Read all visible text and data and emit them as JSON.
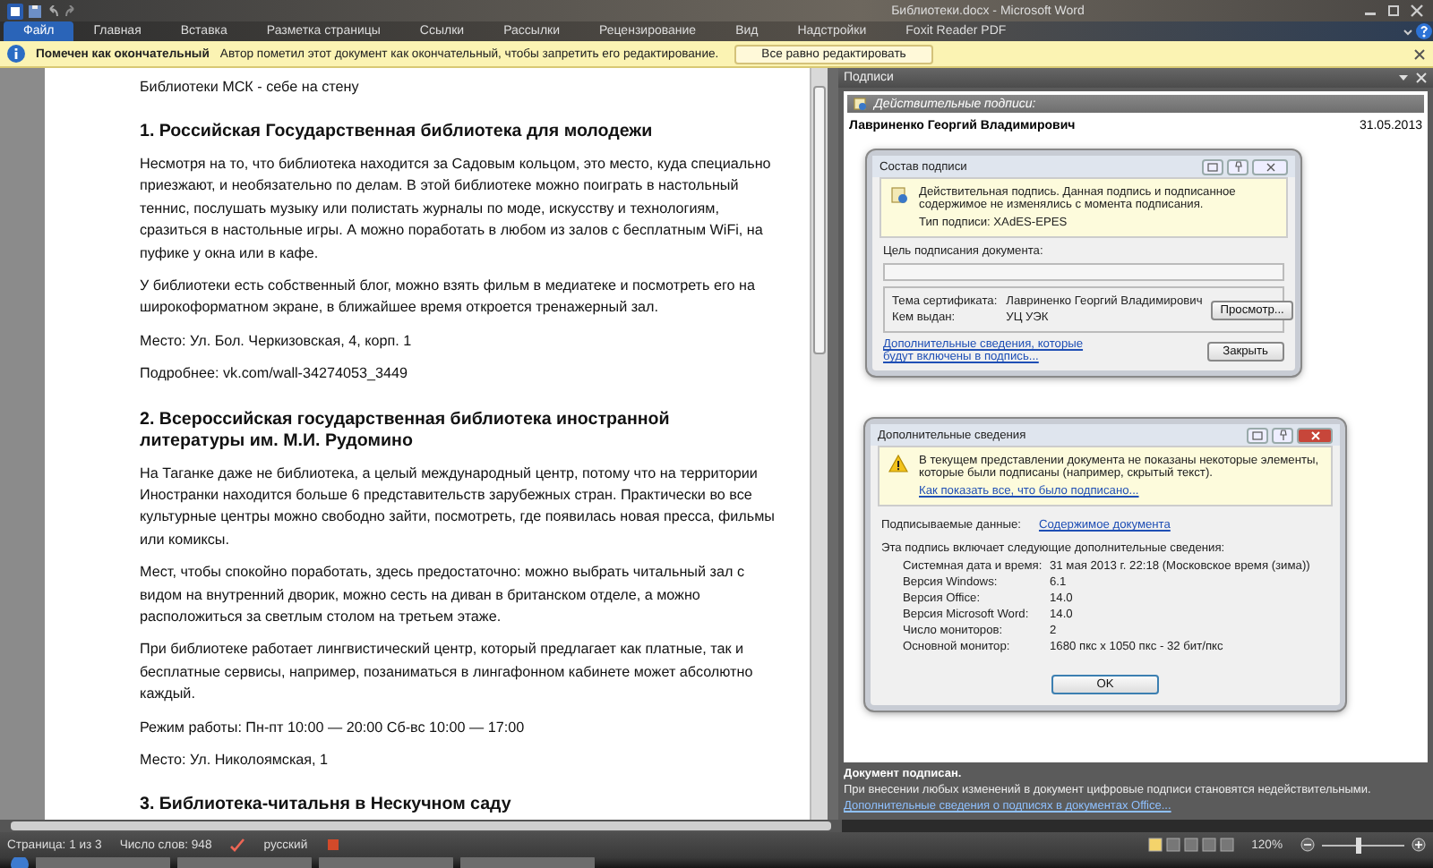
{
  "window": {
    "title": "Библиотеки.docx - Microsoft Word"
  },
  "ribbon_tabs": [
    {
      "label": "Файл",
      "selected": true
    },
    {
      "label": "Главная",
      "selected": false
    },
    {
      "label": "Вставка",
      "selected": false
    },
    {
      "label": "Разметка страницы",
      "selected": false
    },
    {
      "label": "Ссылки",
      "selected": false
    },
    {
      "label": "Рассылки",
      "selected": false
    },
    {
      "label": "Рецензирование",
      "selected": false
    },
    {
      "label": "Вид",
      "selected": false
    },
    {
      "label": "Надстройки",
      "selected": false
    },
    {
      "label": "Foxit Reader PDF",
      "selected": false
    }
  ],
  "message_bar": {
    "title": "Помечен как окончательный",
    "text": "Автор пометил этот документ как окончательный, чтобы запретить его редактирование.",
    "button": "Все равно редактировать"
  },
  "document": {
    "title": "Библиотеки МСК - себе на стену",
    "blocks": [
      {
        "kind": "heading",
        "text": "1. Российская Государственная библиотека для молодежи"
      },
      {
        "kind": "paragraph",
        "text": "Несмотря на то, что библиотека находится за Садовым кольцом, это место, куда специально приезжают, и необязательно по делам. В этой библиотеке можно поиграть в настольный теннис, послушать музыку или полистать журналы по моде, искусству и технологиям, сразиться в настольные игры. А можно поработать в любом из залов с бесплатным WiFi, на пуфике у окна или в кафе."
      },
      {
        "kind": "paragraph",
        "text": "У библиотеки есть собственный блог, можно взять фильм в медиатеке и посмотреть его на широкоформатном экране, в ближайшее время откроется тренажерный зал."
      },
      {
        "kind": "paragraph",
        "text": "Место: Ул. Бол. Черкизовская, 4, корп. 1"
      },
      {
        "kind": "paragraph",
        "text": "Подробнее: vk.com/wall-34274053_3449"
      },
      {
        "kind": "heading",
        "text": "2. Всероссийская государственная библиотека иностранной литературы им. М.И. Рудомино"
      },
      {
        "kind": "paragraph",
        "text": "На Таганке даже не библиотека, а целый международный центр, потому что на территории Иностранки находится больше 6 представительств зарубежных стран. Практически во все культурные центры можно свободно зайти, посмотреть, где появилась новая пресса, фильмы или комиксы."
      },
      {
        "kind": "paragraph",
        "text": "Мест, чтобы спокойно поработать, здесь предостаточно: можно выбрать читальный зал с видом на внутренний дворик, можно сесть на диван в британском отделе, а можно расположиться за светлым столом на третьем этаже."
      },
      {
        "kind": "paragraph",
        "text": "При библиотеке работает лингвистический центр, который предлагает как платные, так и бесплатные сервисы, например, позаниматься в лингафонном кабинете может абсолютно каждый."
      },
      {
        "kind": "paragraph",
        "text": "Режим работы: Пн-пт 10:00 — 20:00 Сб-вс 10:00 — 17:00"
      },
      {
        "kind": "paragraph",
        "text": "Место: Ул. Николоямская, 1"
      },
      {
        "kind": "heading",
        "text": "3. Библиотека-читальня в Нескучном саду"
      }
    ]
  },
  "signatures_pane": {
    "title": "Подписи",
    "section": "Действительные подписи:",
    "signer": "Лавриненко Георгий Владимирович",
    "date": "31.05.2013",
    "signature_dialog": {
      "title": "Состав подписи",
      "status": "Действительная подпись. Данная подпись и подписанное содержимое не изменялись с момента подписания.",
      "type": "Тип подписи: XAdES-EPES",
      "purpose_label": "Цель подписания документа:",
      "subject_label": "Тема сертификата:",
      "subject": "Лавриненко Георгий Владимирович",
      "issuer_label": "Кем выдан:",
      "issuer": "УЦ УЭК",
      "view_button": "Просмотр...",
      "link": "Дополнительные сведения, которые будут включены в подпись...",
      "close_button": "Закрыть"
    },
    "details_dialog": {
      "title": "Дополнительные сведения",
      "warning": "В текущем представлении документа не показаны некоторые элементы, которые были подписаны (например, скрытый текст).",
      "warning_link": "Как показать все, что было подписано...",
      "data_label": "Подписываемые данные:",
      "data_link": "Содержимое документа",
      "intro": "Эта подпись включает следующие дополнительные сведения:",
      "rows": [
        {
          "label": "Системная дата и время:",
          "value": "31 мая 2013 г. 22:18 (Московское время (зима))"
        },
        {
          "label": "Версия Windows:",
          "value": "6.1"
        },
        {
          "label": "Версия Office:",
          "value": "14.0"
        },
        {
          "label": "Версия Microsoft Word:",
          "value": "14.0"
        },
        {
          "label": "Число мониторов:",
          "value": "2"
        },
        {
          "label": "Основной монитор:",
          "value": "1680 пкс x 1050 пкс - 32 бит/пкс"
        }
      ],
      "ok_button": "OK"
    },
    "footer": {
      "title": "Документ подписан.",
      "text": "При внесении любых изменений в документ цифровые подписи становятся недействительными.",
      "link": "Дополнительные сведения о подписях в документах Office..."
    }
  },
  "status_bar": {
    "page": "Страница: 1 из 3",
    "words": "Число слов: 948",
    "language": "русский",
    "zoom": "120%",
    "zoom_slider": {
      "level": 0.45
    }
  }
}
